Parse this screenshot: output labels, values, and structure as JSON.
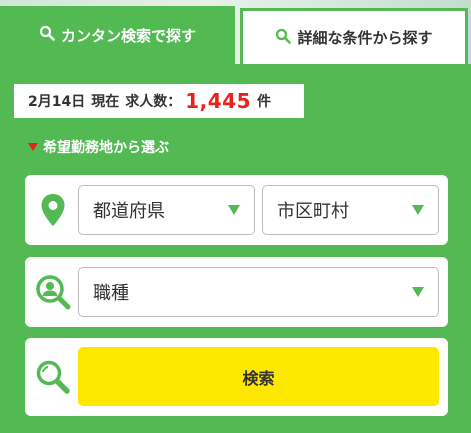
{
  "tabs": {
    "simple_label": "カンタン検索で探す",
    "detail_label": "詳細な条件から探す"
  },
  "count": {
    "date": "2月14日",
    "current": "現在",
    "label": "求人数：",
    "value": "1,445",
    "unit": "件"
  },
  "section": {
    "title": "希望勤務地から選ぶ"
  },
  "prefecture_select": {
    "value": "都道府県"
  },
  "city_select": {
    "value": "市区町村"
  },
  "job_select": {
    "value": "職種"
  },
  "search_button": {
    "label": "検索"
  },
  "colors": {
    "primary_green": "#53b953",
    "accent_red": "#e8231a",
    "button_yellow": "#ffe800"
  },
  "icons": [
    "search-icon",
    "map-pin-icon",
    "person-search-icon",
    "chevron-down-icon"
  ]
}
